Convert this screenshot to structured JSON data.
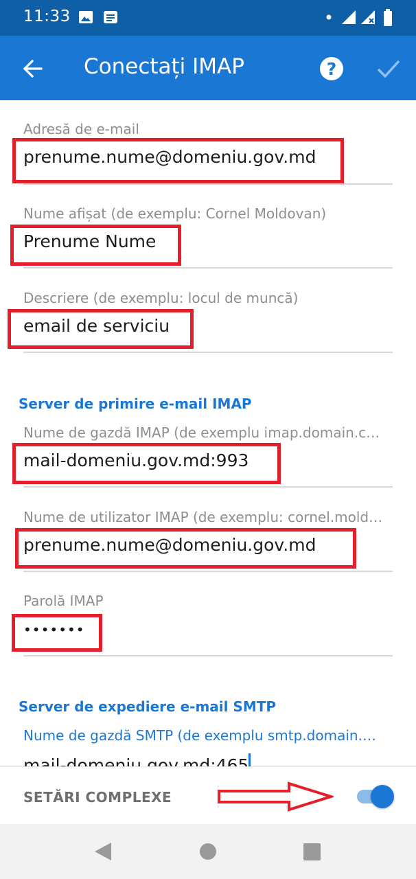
{
  "status_bar": {
    "time": "11:33"
  },
  "app_bar": {
    "title": "Conectați IMAP"
  },
  "account": {
    "email_label": "Adresă de e-mail",
    "email_value": "prenume.nume@domeniu.gov.md",
    "display_name_label": "Nume afișat (de exemplu: Cornel Moldovan)",
    "display_name_value": "Prenume Nume",
    "description_label": "Descriere (de exemplu: locul de muncă)",
    "description_value": "email de serviciu"
  },
  "imap": {
    "section_title": "Server de primire e-mail IMAP",
    "host_label": "Nume de gazdă IMAP (de exemplu imap.domain.c…",
    "host_value": "mail-domeniu.gov.md:993",
    "user_label": "Nume de utilizator IMAP (de exemplu: cornel.mold…",
    "user_value": "prenume.nume@domeniu.gov.md",
    "password_label": "Parolă IMAP",
    "password_value": "•••••••"
  },
  "smtp": {
    "section_title": "Server de expediere e-mail SMTP",
    "host_label": "Nume de gazdă SMTP (de exemplu smtp.domain.…",
    "host_value": "mail-domeniu.gov.md:465"
  },
  "bottom": {
    "advanced_label": "SETĂRI COMPLEXE",
    "advanced_enabled": true
  },
  "colors": {
    "status_bar": "#0e5fa6",
    "app_bar": "#1a78d4",
    "accent": "#1a78d4",
    "annotation": "#e31f2b"
  }
}
